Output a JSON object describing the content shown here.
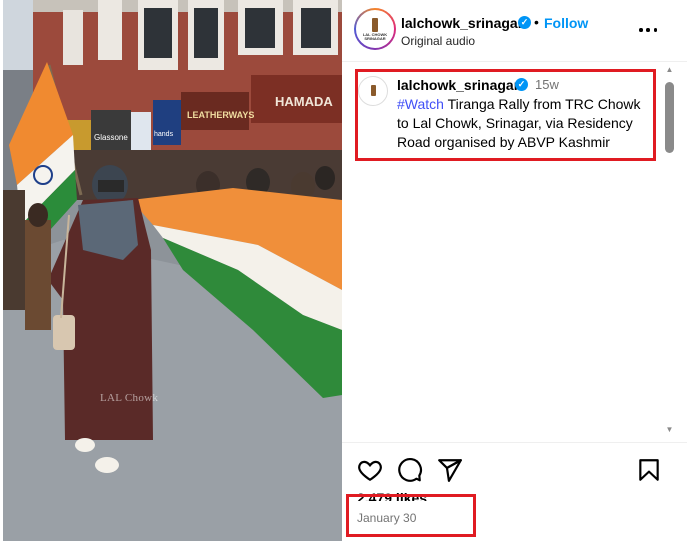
{
  "post": {
    "username": "lalchowk_srinagar",
    "follow_label": "Follow",
    "audio_label": "Original audio",
    "separator": "•"
  },
  "avatar": {
    "logo_text_line1": "LAL CHOWK",
    "logo_text_line2": "SRINAGAR"
  },
  "caption": {
    "username": "lalchowk_srinagar",
    "time_ago": "15w",
    "hashtag": "#Watch",
    "text": " Tiranga Rally from TRC Chowk to Lal Chowk, Srinagar, via Residency Road organised by ABVP Kashmir"
  },
  "media": {
    "watermark": "LAL Chowk",
    "signs": {
      "hamada": "HAMADA",
      "leatherways": "LEATHERWAYS",
      "glassone": "Glassone",
      "hands": "hands"
    }
  },
  "engagement": {
    "likes": "2,479 likes",
    "date": "January 30"
  },
  "icons": {
    "verified": "verified-badge-icon",
    "more": "more-options-icon",
    "like": "heart-icon",
    "comment": "comment-bubble-icon",
    "share": "paper-plane-icon",
    "save": "bookmark-icon"
  },
  "colors": {
    "accent_blue": "#0095f6",
    "hashtag": "#4150f7",
    "highlight_red": "#e01b22",
    "muted_text": "#737373"
  }
}
